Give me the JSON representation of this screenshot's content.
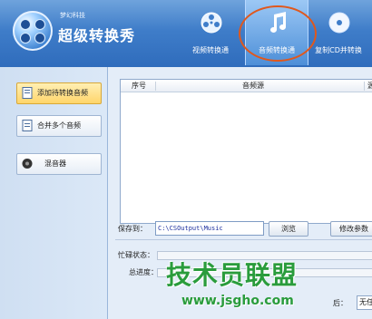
{
  "brand": {
    "small": "梦幻科技",
    "title": "超级转换秀"
  },
  "tabs": [
    {
      "label": "视频转换通",
      "icon": "film-reel-icon"
    },
    {
      "label": "音频转换通",
      "icon": "music-note-icon",
      "active": true
    },
    {
      "label": "复制CD并转换",
      "icon": "cd-disc-icon"
    }
  ],
  "sidebar": {
    "items": [
      {
        "label": "添加待转换音频",
        "icon": "audio-file-icon",
        "active": true
      },
      {
        "label": "合并多个音频",
        "icon": "merge-file-icon"
      },
      {
        "label": "混音器",
        "icon": "speaker-icon"
      }
    ]
  },
  "list": {
    "columns": [
      "序号",
      "音频源",
      "源"
    ]
  },
  "save": {
    "label": "保存到：",
    "path": "C:\\CSOutput\\Music",
    "browse": "浏览",
    "modify": "修改参数"
  },
  "status": {
    "busy_label": "忙碌状态：",
    "progress_label": "总进度：",
    "after_label": "后：",
    "after_value": "无任"
  },
  "watermark": {
    "cn": "技术员联盟",
    "url": "www.jsgho.com"
  },
  "colors": {
    "accent": "#e0581d",
    "header": "#3f7dc9",
    "watermark": "#2a9c3c"
  }
}
